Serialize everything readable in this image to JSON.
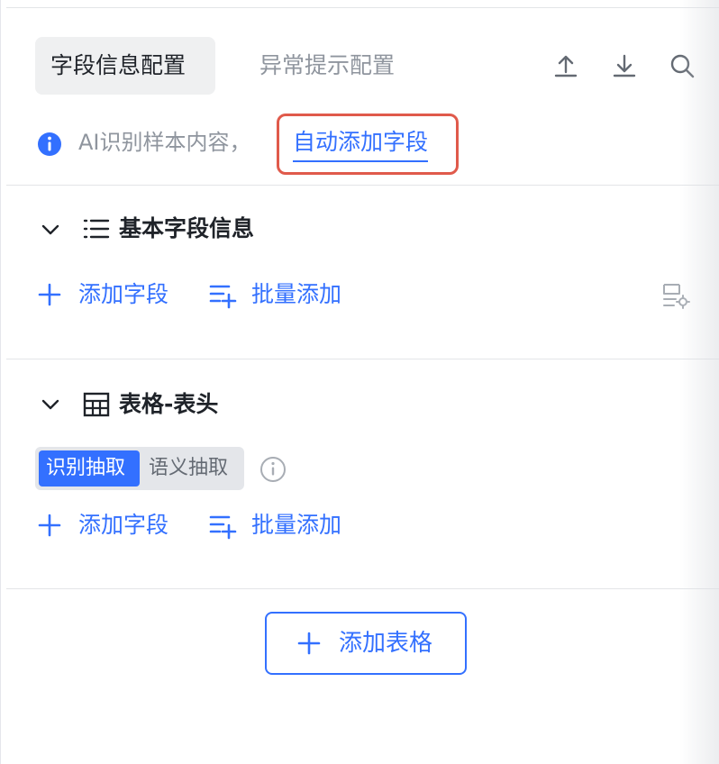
{
  "tabs": [
    {
      "label": "字段信息配置",
      "active": true
    },
    {
      "label": "异常提示配置",
      "active": false
    }
  ],
  "toolbar": {
    "icons": [
      "upload-icon",
      "download-icon",
      "search-icon"
    ]
  },
  "ai_hint": {
    "text": "AI识别样本内容，",
    "link": "自动添加字段"
  },
  "sections": [
    {
      "title": "基本字段信息",
      "icon": "list-icon",
      "actions": {
        "add": "添加字段",
        "batch": "批量添加"
      }
    },
    {
      "title": "表格-表头",
      "icon": "table-icon",
      "segmented": {
        "options": [
          "识别抽取",
          "语义抽取"
        ],
        "selected": "识别抽取"
      },
      "actions": {
        "add": "添加字段",
        "batch": "批量添加"
      }
    }
  ],
  "add_table_label": "添加表格",
  "colors": {
    "accent": "#3370ff",
    "highlight_border": "#e05a4b",
    "muted": "#8f959e"
  }
}
